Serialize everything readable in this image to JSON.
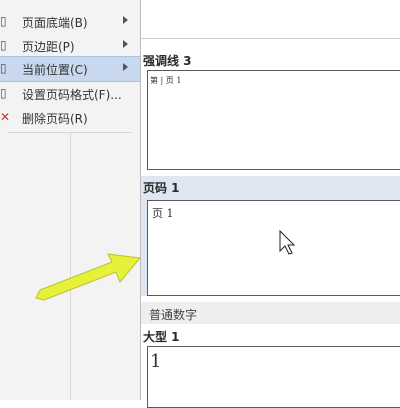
{
  "menu": {
    "items": [
      {
        "label": "页面底端(B)",
        "icon": "page-bottom-icon",
        "has_submenu": true
      },
      {
        "label": "页边距(P)",
        "icon": "page-margin-icon",
        "has_submenu": true
      },
      {
        "label": "当前位置(C)",
        "icon": "current-position-icon",
        "has_submenu": true
      },
      {
        "label": "设置页码格式(F)...",
        "icon": "format-page-number-icon",
        "has_submenu": false
      },
      {
        "label": "删除页码(R)",
        "icon": "remove-page-number-icon",
        "has_submenu": false
      }
    ]
  },
  "gallery": {
    "top_item_label": "强调线 3",
    "top_thumb_text": "第 | 页 1",
    "section_header": "页码 1",
    "selected_thumb_text": "页 1",
    "group_header": "普通数字",
    "bottom_item_label": "大型 1",
    "bottom_thumb_text": "1"
  },
  "colors": {
    "hover_bg": "#c8d9ef",
    "section_header_bg": "#dde6f1",
    "arrow_fill": "#e6f23a"
  }
}
